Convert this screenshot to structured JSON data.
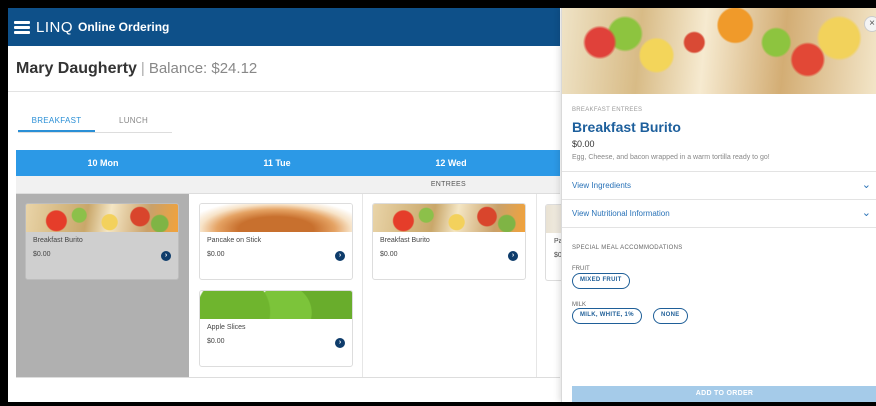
{
  "app": {
    "brand_linq": "LINQ",
    "brand_sub": "Online Ordering"
  },
  "user": {
    "name": "Mary Daugherty",
    "separator": "|",
    "balance": "Balance: $24.12"
  },
  "tabs": [
    {
      "label": "BREAKFAST",
      "active": true
    },
    {
      "label": "LUNCH",
      "active": false
    }
  ],
  "days": [
    "10 Mon",
    "11 Tue",
    "12 Wed"
  ],
  "section_label": "ENTREES",
  "menu_items": [
    {
      "name": "Breakfast Burito",
      "price": "$0.00",
      "image": "burrito-image"
    },
    {
      "name": "Pancake on Stick",
      "price": "$0.00",
      "image": "pancake-image"
    },
    {
      "name": "Apple Slices",
      "price": "$0.00",
      "image": "apple-image"
    },
    {
      "name": "Breakfast Burito",
      "price": "$0.00",
      "image": "burrito-image"
    }
  ],
  "partial_card": {
    "name": "Pa",
    "price": "$0"
  },
  "detail": {
    "category": "BREAKFAST ENTREES",
    "title": "Breakfast Burito",
    "price": "$0.00",
    "description": "Egg, Cheese, and bacon wrapped in a warm tortilla ready to go!",
    "view_ingredients": "View Ingredients",
    "view_nutrition": "View Nutritional Information",
    "accommodations_label": "SPECIAL MEAL ACCOMMODATIONS",
    "fruit_label": "FRUIT",
    "fruit_options": [
      "MIXED FRUIT"
    ],
    "milk_label": "MILK",
    "milk_options": [
      "MILK, WHITE, 1%",
      "NONE"
    ],
    "add_button": "ADD TO ORDER",
    "close_glyph": "×",
    "chevron_glyph": "⌄"
  },
  "icons": {
    "menu": "hamburger-icon",
    "go": "arrow-right-circle-icon",
    "close": "close-icon",
    "chevron": "chevron-down-icon"
  },
  "colors": {
    "header": "#0e5089",
    "days_bar": "#2c99e6",
    "accent": "#1d5f9c",
    "add_button": "#a5cbe9"
  }
}
